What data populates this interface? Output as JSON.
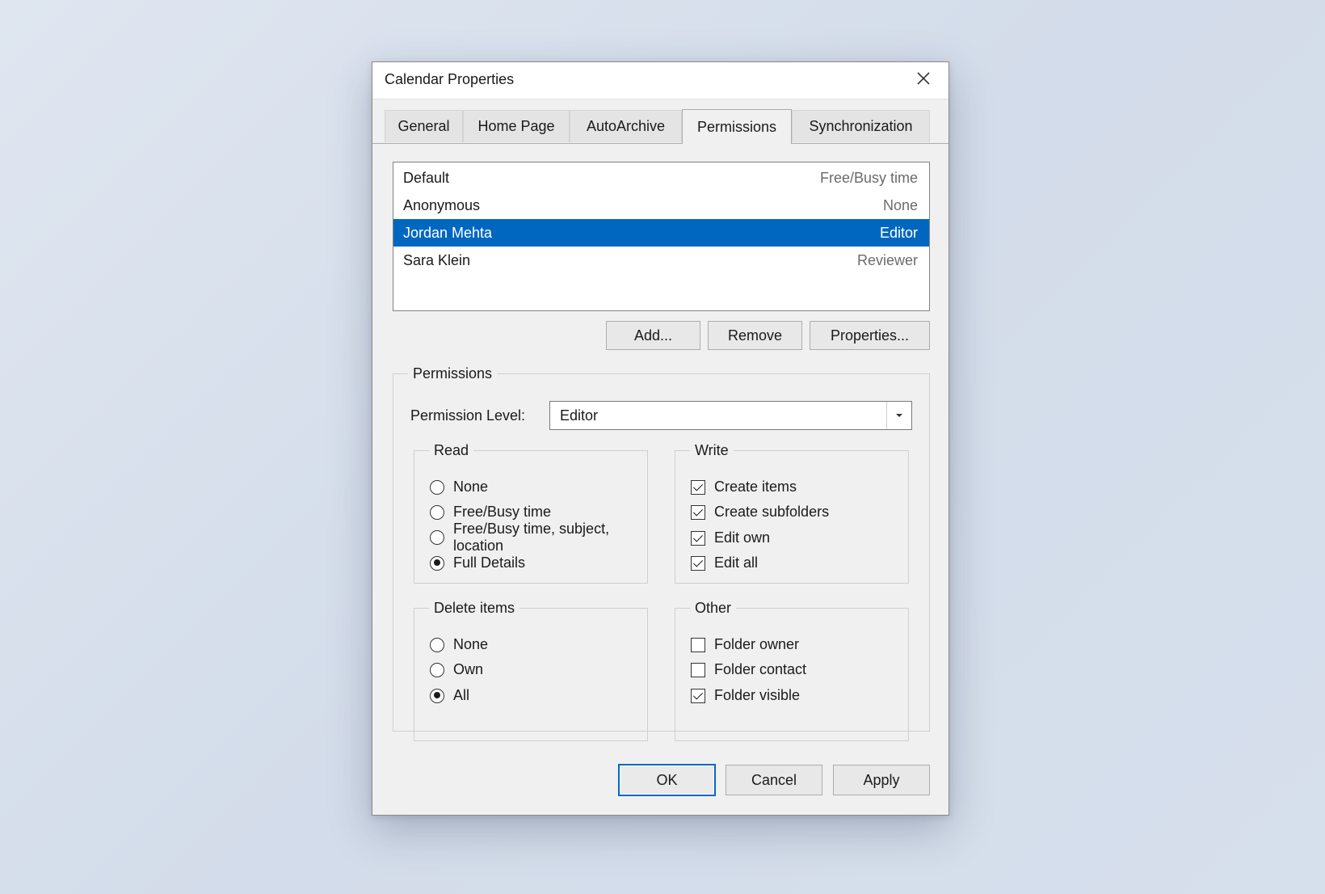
{
  "dialog": {
    "title": "Calendar Properties",
    "close_icon": "close-icon"
  },
  "tabs": [
    {
      "label": "General",
      "active": false
    },
    {
      "label": "Home Page",
      "active": false
    },
    {
      "label": "AutoArchive",
      "active": false
    },
    {
      "label": "Permissions",
      "active": true
    },
    {
      "label": "Synchronization",
      "active": false
    }
  ],
  "users": [
    {
      "name": "Default",
      "permission": "Free/Busy time",
      "selected": false
    },
    {
      "name": "Anonymous",
      "permission": "None",
      "selected": false
    },
    {
      "name": "Jordan Mehta",
      "permission": "Editor",
      "selected": true
    },
    {
      "name": "Sara Klein",
      "permission": "Reviewer",
      "selected": false
    }
  ],
  "list_buttons": {
    "add": "Add...",
    "remove": "Remove",
    "properties": "Properties..."
  },
  "permissions": {
    "legend": "Permissions",
    "level_label": "Permission Level:",
    "level_value": "Editor",
    "read": {
      "legend": "Read",
      "options": [
        {
          "label": "None",
          "selected": false
        },
        {
          "label": "Free/Busy time",
          "selected": false
        },
        {
          "label_line1": "Free/Busy time, subject,",
          "label_line2": "location",
          "selected": false
        },
        {
          "label": "Full Details",
          "selected": true
        }
      ]
    },
    "write": {
      "legend": "Write",
      "options": [
        {
          "label": "Create items",
          "checked": true
        },
        {
          "label": "Create subfolders",
          "checked": true
        },
        {
          "label": "Edit own",
          "checked": true
        },
        {
          "label": "Edit all",
          "checked": true
        }
      ]
    },
    "delete": {
      "legend": "Delete items",
      "options": [
        {
          "label": "None",
          "selected": false
        },
        {
          "label": "Own",
          "selected": false
        },
        {
          "label": "All",
          "selected": true
        }
      ]
    },
    "other": {
      "legend": "Other",
      "options": [
        {
          "label": "Folder owner",
          "checked": false
        },
        {
          "label": "Folder contact",
          "checked": false
        },
        {
          "label": "Folder visible",
          "checked": true
        }
      ]
    }
  },
  "footer": {
    "ok": "OK",
    "cancel": "Cancel",
    "apply": "Apply"
  },
  "colors": {
    "selection": "#0067c0",
    "dialog_bg": "#f0f0f0",
    "focus_border": "#0067c0"
  }
}
